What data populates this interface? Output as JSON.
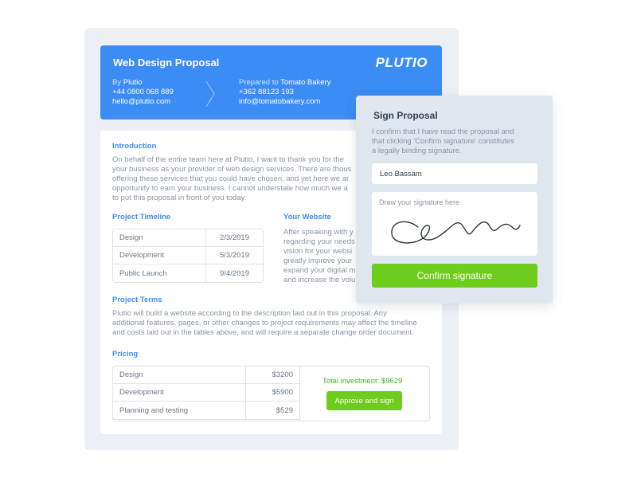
{
  "header": {
    "title": "Web Design Proposal",
    "logo": "PLUTIO",
    "from": {
      "by_label": "By",
      "name": "Plutio",
      "phone": "+44 0800 068 889",
      "email": "hello@plutio.com"
    },
    "to": {
      "prepared_label": "Prepared to",
      "name": "Tomato Bakery",
      "phone": "+362 88123 193",
      "email": "info@tomatobakery.com"
    }
  },
  "doc": {
    "introduction": {
      "title": "Introduction",
      "lines": [
        "On behalf of the entire team here at Plutio, I want to thank you for the",
        "your business as your provider of web design services. There are thous",
        "offering these services that you could have chosen, and yet here we ar",
        "opportunity to earn your business. I cannot understate how much we a",
        "to put this proposal in front of you today."
      ]
    },
    "timeline": {
      "title": "Project Timeline",
      "rows": [
        {
          "label": "Design",
          "date": "2/3/2019"
        },
        {
          "label": "Development",
          "date": "5/3/2019"
        },
        {
          "label": "Public Launch",
          "date": "9/4/2019"
        }
      ]
    },
    "website": {
      "title": "Your Website",
      "lines": [
        "After speaking with y",
        "regarding your needs",
        "vision for your websi",
        "greatly improve your",
        "expand your digital m",
        "and increase the volu"
      ]
    },
    "terms": {
      "title": "Project Terms",
      "lines": [
        "Plutio will build a website according to the description laid out in this proposal. Any",
        "additional features, pages, or other changes to project requirements may affect the timeline",
        "and costs laid out in the tables above, and will require a separate change order document."
      ]
    },
    "pricing": {
      "title": "Pricing",
      "rows": [
        {
          "label": "Design",
          "amount": "$3200"
        },
        {
          "label": "Development",
          "amount": "$5900"
        },
        {
          "label": "Planning and testing",
          "amount": "$529"
        }
      ],
      "total": "Total investment: $9629",
      "approve_label": "Approve and sign"
    }
  },
  "sign": {
    "title": "Sign Proposal",
    "desc_lines": [
      "I confirm that I have read the proposal and",
      "that clicking 'Confirm signature' constitutes",
      "a legally binding signature."
    ],
    "name_value": "Leo Bassam",
    "signature_placeholder": "Draw your signature here",
    "confirm_label": "Confirm signature"
  },
  "colors": {
    "accent": "#3b8cf4",
    "success": "#6ecc1c",
    "panel": "#dfe6ee",
    "page_bg": "#eceff4"
  }
}
